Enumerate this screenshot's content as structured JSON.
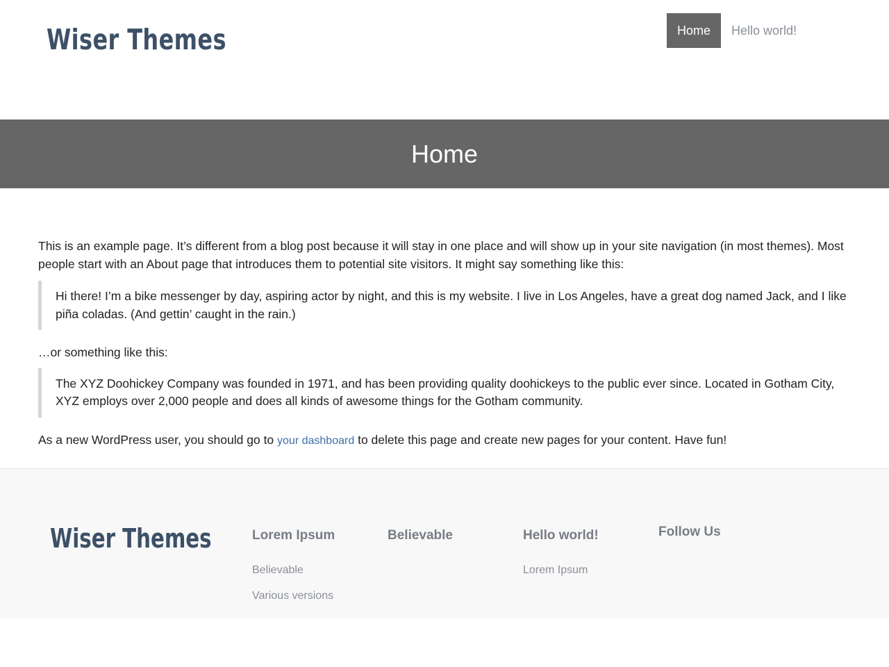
{
  "site": {
    "logo_text": "Wiser Themes"
  },
  "nav": [
    {
      "label": "Home"
    },
    {
      "label": "Hello world!"
    }
  ],
  "page": {
    "title": "Home"
  },
  "content": {
    "intro": "This is an example page. It’s different from a blog post because it will stay in one place and will show up in your site navigation (in most themes). Most people start with an About page that introduces them to potential site visitors. It might say something like this:",
    "quote1": "Hi there! I’m a bike messenger by day, aspiring actor by night, and this is my website. I live in Los Angeles, have a great dog named Jack, and I like piña coladas. (And gettin’ caught in the rain.)",
    "or_text": "…or something like this:",
    "quote2": "The XYZ Doohickey Company was founded in 1971, and has been providing quality doohickeys to the public ever since. Located in Gotham City, XYZ employs over 2,000 people and does all kinds of awesome things for the Gotham community.",
    "final_before": "As a new WordPress user, you should go to ",
    "dashboard_link": "your dashboard",
    "final_after": " to delete this page and create new pages for your content. Have fun!"
  },
  "footer": {
    "logo_text": "Wiser Themes",
    "columns": [
      {
        "title": "Lorem Ipsum",
        "links": [
          "Believable",
          "Various versions"
        ]
      },
      {
        "title": "Believable",
        "links": []
      },
      {
        "title": "Hello world!",
        "links": [
          "Lorem Ipsum"
        ]
      },
      {
        "title": "Follow Us",
        "links": []
      }
    ]
  }
}
